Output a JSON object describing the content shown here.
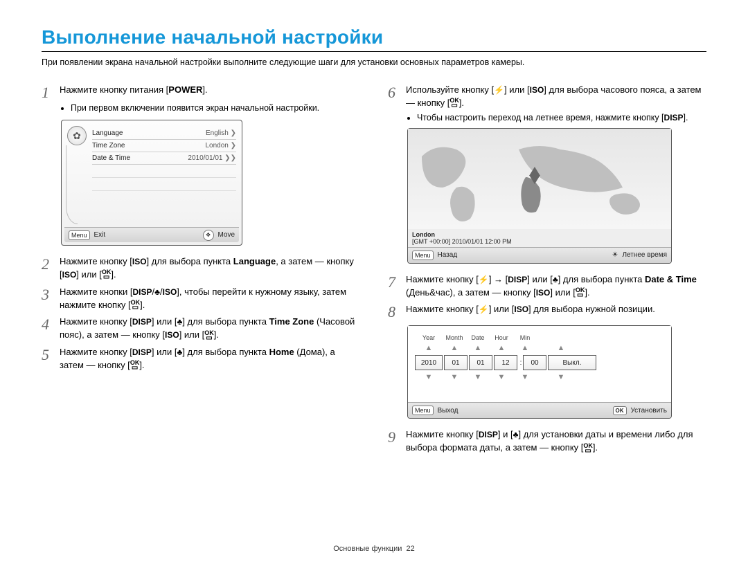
{
  "title": "Выполнение начальной настройки",
  "intro": "При появлении экрана начальной настройки выполните следующие шаги для установки основных параметров камеры.",
  "steps": {
    "s1": {
      "a": "Нажмите кнопку питания [",
      "power": "POWER",
      "b": "]."
    },
    "s1bullet": "При первом включении появится экран начальной настройки.",
    "s2": {
      "a": "Нажмите кнопку [",
      "iso": "ISO",
      "b": "] для выбора пункта ",
      "lang": "Language",
      "c": ", а затем — кнопку [",
      "iso2": "ISO",
      "d": "] или [",
      "e": "]."
    },
    "s3": {
      "a": "Нажмите кнопки [",
      "disp": "DISP",
      "sl1": "/",
      "mac": "♣",
      "sl2": "/",
      "iso": "ISO",
      "b": "], чтобы перейти к нужному языку, затем нажмите кнопку [",
      "c": "]."
    },
    "s4": {
      "a": "Нажмите кнопку [",
      "disp": "DISP",
      "b": "] или [",
      "mac": "♣",
      "c": "] для выбора пункта ",
      "tz": "Time Zone",
      "tzru": " (Часовой пояс), а затем — кнопку [",
      "iso": "ISO",
      "d": "] или [",
      "e": "]."
    },
    "s5": {
      "a": "Нажмите кнопку [",
      "disp": "DISP",
      "b": "] или [",
      "mac": "♣",
      "c": "] для выбора пункта ",
      "home": "Home",
      "homeru": " (Дома), а затем — кнопку [",
      "d": "]."
    },
    "s6": {
      "a": "Используйте кнопку [",
      "fl": "⚡",
      "b": "] или [",
      "iso": "ISO",
      "c": "] для выбора часового пояса, а затем — кнопку [",
      "d": "]."
    },
    "s6bullet": {
      "a": "Чтобы настроить переход на летнее время, нажмите кнопку [",
      "disp": "DISP",
      "b": "]."
    },
    "s7": {
      "a": "Нажмите кнопку [",
      "fl": "⚡",
      "b": "] → [",
      "disp": "DISP",
      "c": "] или [",
      "mac": "♣",
      "d": "] для выбора пункта ",
      "dt": "Date & Time",
      "dtru": " (День&час), а затем — кнопку [",
      "iso": "ISO",
      "e": "] или [",
      "f": "]."
    },
    "s8": {
      "a": "Нажмите кнопку [",
      "fl": "⚡",
      "b": "] или [",
      "iso": "ISO",
      "c": "] для выбора нужной позиции."
    },
    "s9": {
      "a": "Нажмите кнопку [",
      "disp": "DISP",
      "b": "] и [",
      "mac": "♣",
      "c": "] для установки даты и времени либо для выбора формата даты, а затем — кнопку [",
      "d": "]."
    }
  },
  "shot1": {
    "rows": [
      {
        "l": "Language",
        "r": "English"
      },
      {
        "l": "Time Zone",
        "r": "London"
      },
      {
        "l": "Date & Time",
        "r": "2010/01/01"
      }
    ],
    "menu": "Menu",
    "exit": "Exit",
    "move": "Move"
  },
  "shot2": {
    "city": "London",
    "info": "[GMT +00:00] 2010/01/01 12:00 PM",
    "menu": "Menu",
    "back": "Назад",
    "dst": "Летнее время"
  },
  "shot3": {
    "hdr": [
      "Year",
      "Month",
      "Date",
      "Hour",
      "Min"
    ],
    "cells": [
      "2010",
      "01",
      "01",
      "12",
      "00"
    ],
    "off": "Выкл.",
    "menu": "Menu",
    "exit": "Выход",
    "ok": "OK",
    "set": "Установить"
  },
  "footer": {
    "section": "Основные функции",
    "page": "22"
  }
}
